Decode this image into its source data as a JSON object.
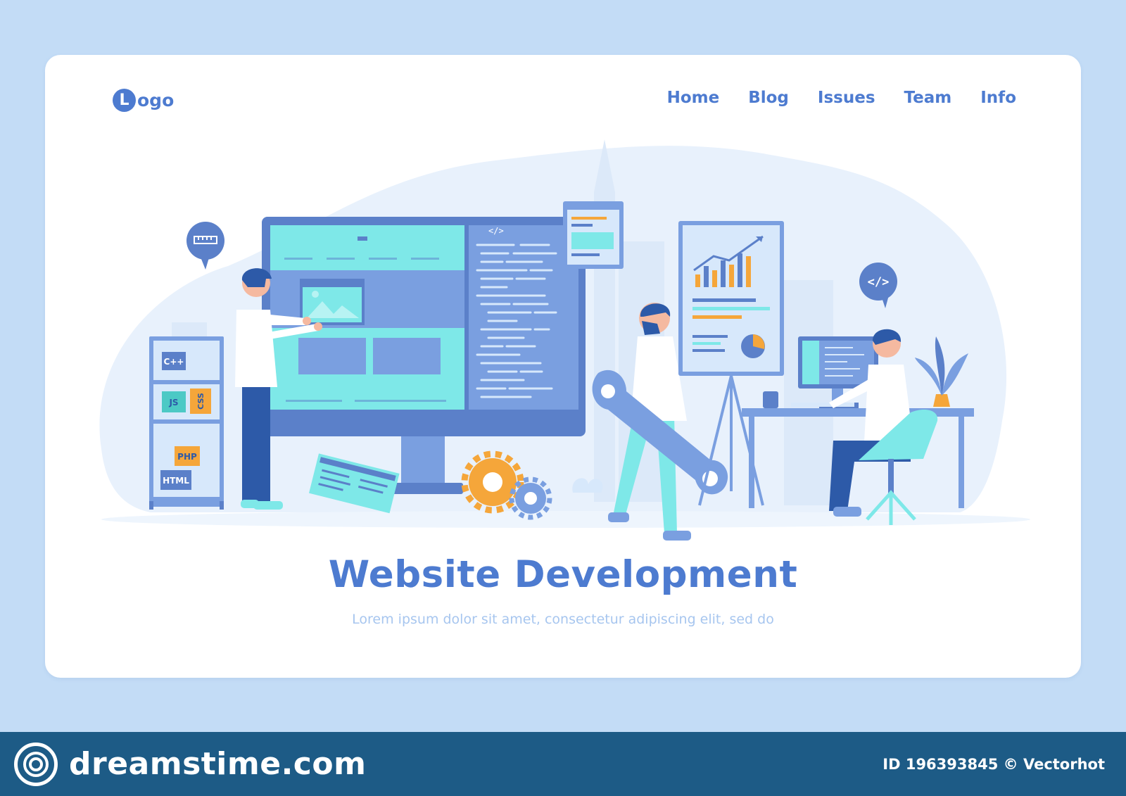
{
  "header": {
    "logo_initial": "L",
    "logo_text": "ogo",
    "nav": [
      {
        "label": "Home"
      },
      {
        "label": "Blog"
      },
      {
        "label": "Issues"
      },
      {
        "label": "Team"
      },
      {
        "label": "Info"
      }
    ]
  },
  "hero": {
    "title": "Website Development",
    "subtitle": "Lorem ipsum dolor sit amet, consectetur adipiscing elit, sed do"
  },
  "illustration": {
    "shelf_tags": [
      "C++",
      "JS",
      "CSS",
      "PHP",
      "HTML"
    ],
    "code_tag": "</>",
    "bubble_code": "</>"
  },
  "colors": {
    "page_bg": "#c3dcf6",
    "primary": "#4d7bd0",
    "accent_teal": "#7ee8e8",
    "accent_orange": "#f5a63a",
    "footer_bg": "#1d5b86"
  },
  "footer": {
    "brand": "dreamstime.com",
    "stock_id": "ID 196393845 © Vectorhot"
  }
}
